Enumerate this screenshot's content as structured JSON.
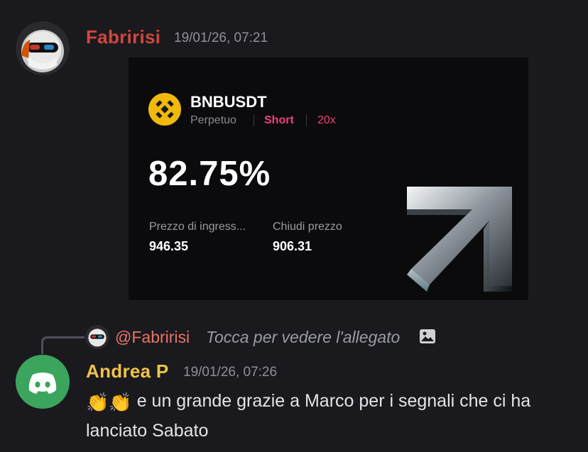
{
  "message1": {
    "author": "Fabririsi",
    "author_color": "#d2463f",
    "timestamp": "19/01/26, 07:21",
    "attachment": {
      "pair": "BNBUSDT",
      "contract_type": "Perpetuo",
      "side": "Short",
      "leverage": "20x",
      "pnl_percent": "82.75%",
      "entry_label": "Prezzo di ingress...",
      "entry_value": "946.35",
      "close_label": "Chiudi prezzo",
      "close_value": "906.31",
      "accent_color": "#f0407a",
      "coin_color": "#f0b90b"
    }
  },
  "reply": {
    "mention": "@Fabririsi",
    "preview_text": "Tocca per vedere l'allegato",
    "icon": "image-icon"
  },
  "message2": {
    "author": "Andrea P",
    "author_color": "#f0c34a",
    "timestamp": "19/01/26, 07:26",
    "emoji": "👏👏",
    "text": "e un grande grazie a Marco per i segnali che ci ha lanciato Sabato",
    "avatar_icon": "discord-icon",
    "avatar_color": "#3ba55d"
  }
}
